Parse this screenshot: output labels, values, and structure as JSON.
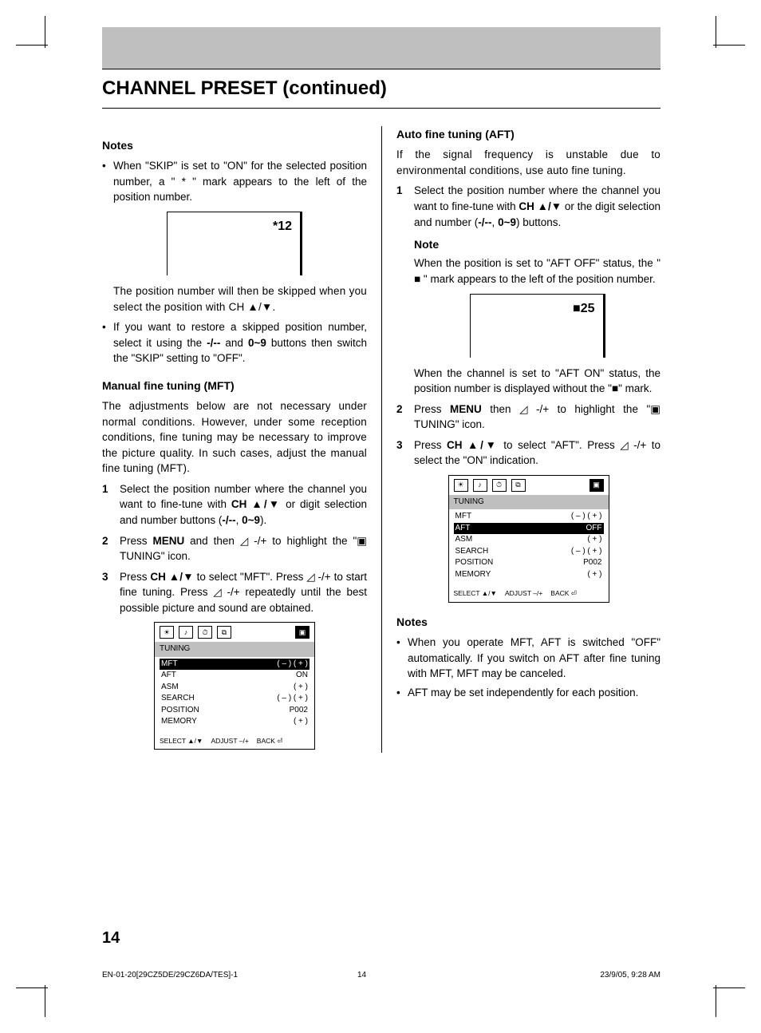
{
  "title": "CHANNEL PRESET (continued)",
  "left": {
    "notes_head": "Notes",
    "note1": "When \"SKIP\" is set to \"ON\" for the selected position number, a \" * \" mark appears to the left of the position number.",
    "screen1": "*12",
    "note1b": "The position number will then be skipped when you select the position with CH ▲/▼.",
    "note2": "If you want to restore a skipped position number, select it using the -/-- and 0~9 buttons then switch the \"SKIP\" setting to \"OFF\".",
    "mft_head": "Manual fine tuning (MFT)",
    "mft_intro": "The adjustments below are not necessary under normal conditions. However, under some reception conditions, fine tuning may be necessary to improve the picture quality. In such cases, adjust the manual fine tuning (MFT).",
    "mft_step1": "Select the position number where the channel you want to fine-tune with CH ▲/▼ or digit selection and number buttons (-/--, 0~9).",
    "mft_step2": "Press MENU and then ◿ -/+ to highlight the \"▣ TUNING\" icon.",
    "mft_step3": "Press CH ▲/▼ to select \"MFT\". Press ◿ -/+ to start fine tuning. Press ◿ -/+ repeatedly until the best possible picture and sound are obtained."
  },
  "right": {
    "aft_head": "Auto fine tuning (AFT)",
    "aft_intro": "If the signal frequency is unstable due to environmental conditions, use auto fine tuning.",
    "aft_step1": "Select the position number where the channel you want to fine-tune with CH ▲/▼ or the digit selection and number (-/--, 0~9) buttons.",
    "aft_note_head": "Note",
    "aft_note1": "When the position is set to \"AFT OFF\" status, the \" ■ \" mark appears to the left of the position number.",
    "screen2": "■25",
    "aft_note1b": "When the channel is set to \"AFT ON\" status, the position number is displayed without the \"■\" mark.",
    "aft_step2": "Press MENU then ◿ -/+ to highlight the \"▣ TUNING\" icon.",
    "aft_step3": "Press CH ▲/▼ to select \"AFT\". Press ◿ -/+ to select the \"ON\" indication.",
    "notes_head": "Notes",
    "noteA": "When you operate MFT, AFT is switched \"OFF\" automatically. If you switch on AFT after fine tuning with MFT, MFT may be canceled.",
    "noteB": "AFT may be set independently for each position."
  },
  "osd_left": {
    "title": "TUNING",
    "rows": [
      {
        "l": "MFT",
        "r": "( – ) ( + )",
        "hl": true
      },
      {
        "l": "AFT",
        "r": "ON"
      },
      {
        "l": "ASM",
        "r": "( + )"
      },
      {
        "l": "SEARCH",
        "r": "( – ) ( + )"
      },
      {
        "l": "POSITION",
        "r": "P002"
      },
      {
        "l": "MEMORY",
        "r": "( + )"
      }
    ],
    "foot": {
      "a": "SELECT ▲/▼",
      "b": "ADJUST –/+",
      "c": "BACK ⏎"
    }
  },
  "osd_right": {
    "title": "TUNING",
    "rows": [
      {
        "l": "MFT",
        "r": "( – ) ( + )"
      },
      {
        "l": "AFT",
        "r": "OFF",
        "hl": true
      },
      {
        "l": "ASM",
        "r": "( + )"
      },
      {
        "l": "SEARCH",
        "r": "( – ) ( + )"
      },
      {
        "l": "POSITION",
        "r": "P002"
      },
      {
        "l": "MEMORY",
        "r": "( + )"
      }
    ],
    "foot": {
      "a": "SELECT ▲/▼",
      "b": "ADJUST –/+",
      "c": "BACK ⏎"
    }
  },
  "page_number": "14",
  "footer": {
    "left": "EN-01-20[29CZ5DE/29CZ6DA/TES]-1",
    "center": "14",
    "right": "23/9/05, 9:28 AM"
  }
}
